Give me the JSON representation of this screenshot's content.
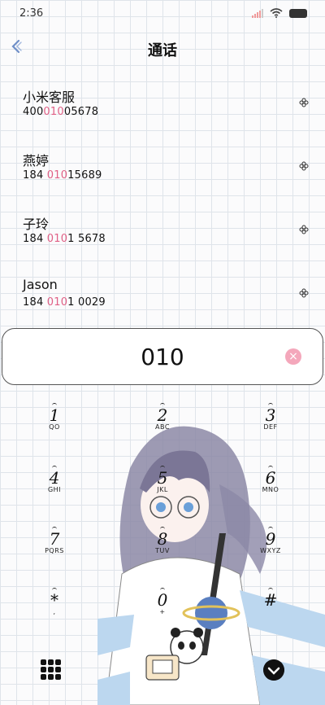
{
  "status": {
    "time": "2:36"
  },
  "header": {
    "title": "通话"
  },
  "contacts": [
    {
      "name": "小米客服",
      "num_pre": "400",
      "num_hl": "010",
      "num_post": "05678"
    },
    {
      "name": "燕婷",
      "num_pre": "184 ",
      "num_hl": "010",
      "num_post": "15689"
    },
    {
      "name": "子玲",
      "num_pre": "184 ",
      "num_hl": "010",
      "num_post": "1 5678"
    },
    {
      "name": "Jason",
      "num_pre": "184 ",
      "num_hl": "010",
      "num_post": "1 0029"
    }
  ],
  "dialer": {
    "number": "010",
    "clear_symbol": "×"
  },
  "keypad": [
    {
      "digit": "1",
      "letters": "QO"
    },
    {
      "digit": "2",
      "letters": "ABC"
    },
    {
      "digit": "3",
      "letters": "DEF"
    },
    {
      "digit": "4",
      "letters": "GHI"
    },
    {
      "digit": "5",
      "letters": "JKL"
    },
    {
      "digit": "6",
      "letters": "MNO"
    },
    {
      "digit": "7",
      "letters": "PQRS"
    },
    {
      "digit": "8",
      "letters": "TUV"
    },
    {
      "digit": "9",
      "letters": "WXYZ"
    },
    {
      "digit": "*",
      "letters": ","
    },
    {
      "digit": "0",
      "letters": "+"
    },
    {
      "digit": "#",
      "letters": ""
    }
  ],
  "colors": {
    "highlight": "#e06086",
    "clear": "#f4a7bb",
    "back": "#6f8fc8"
  }
}
